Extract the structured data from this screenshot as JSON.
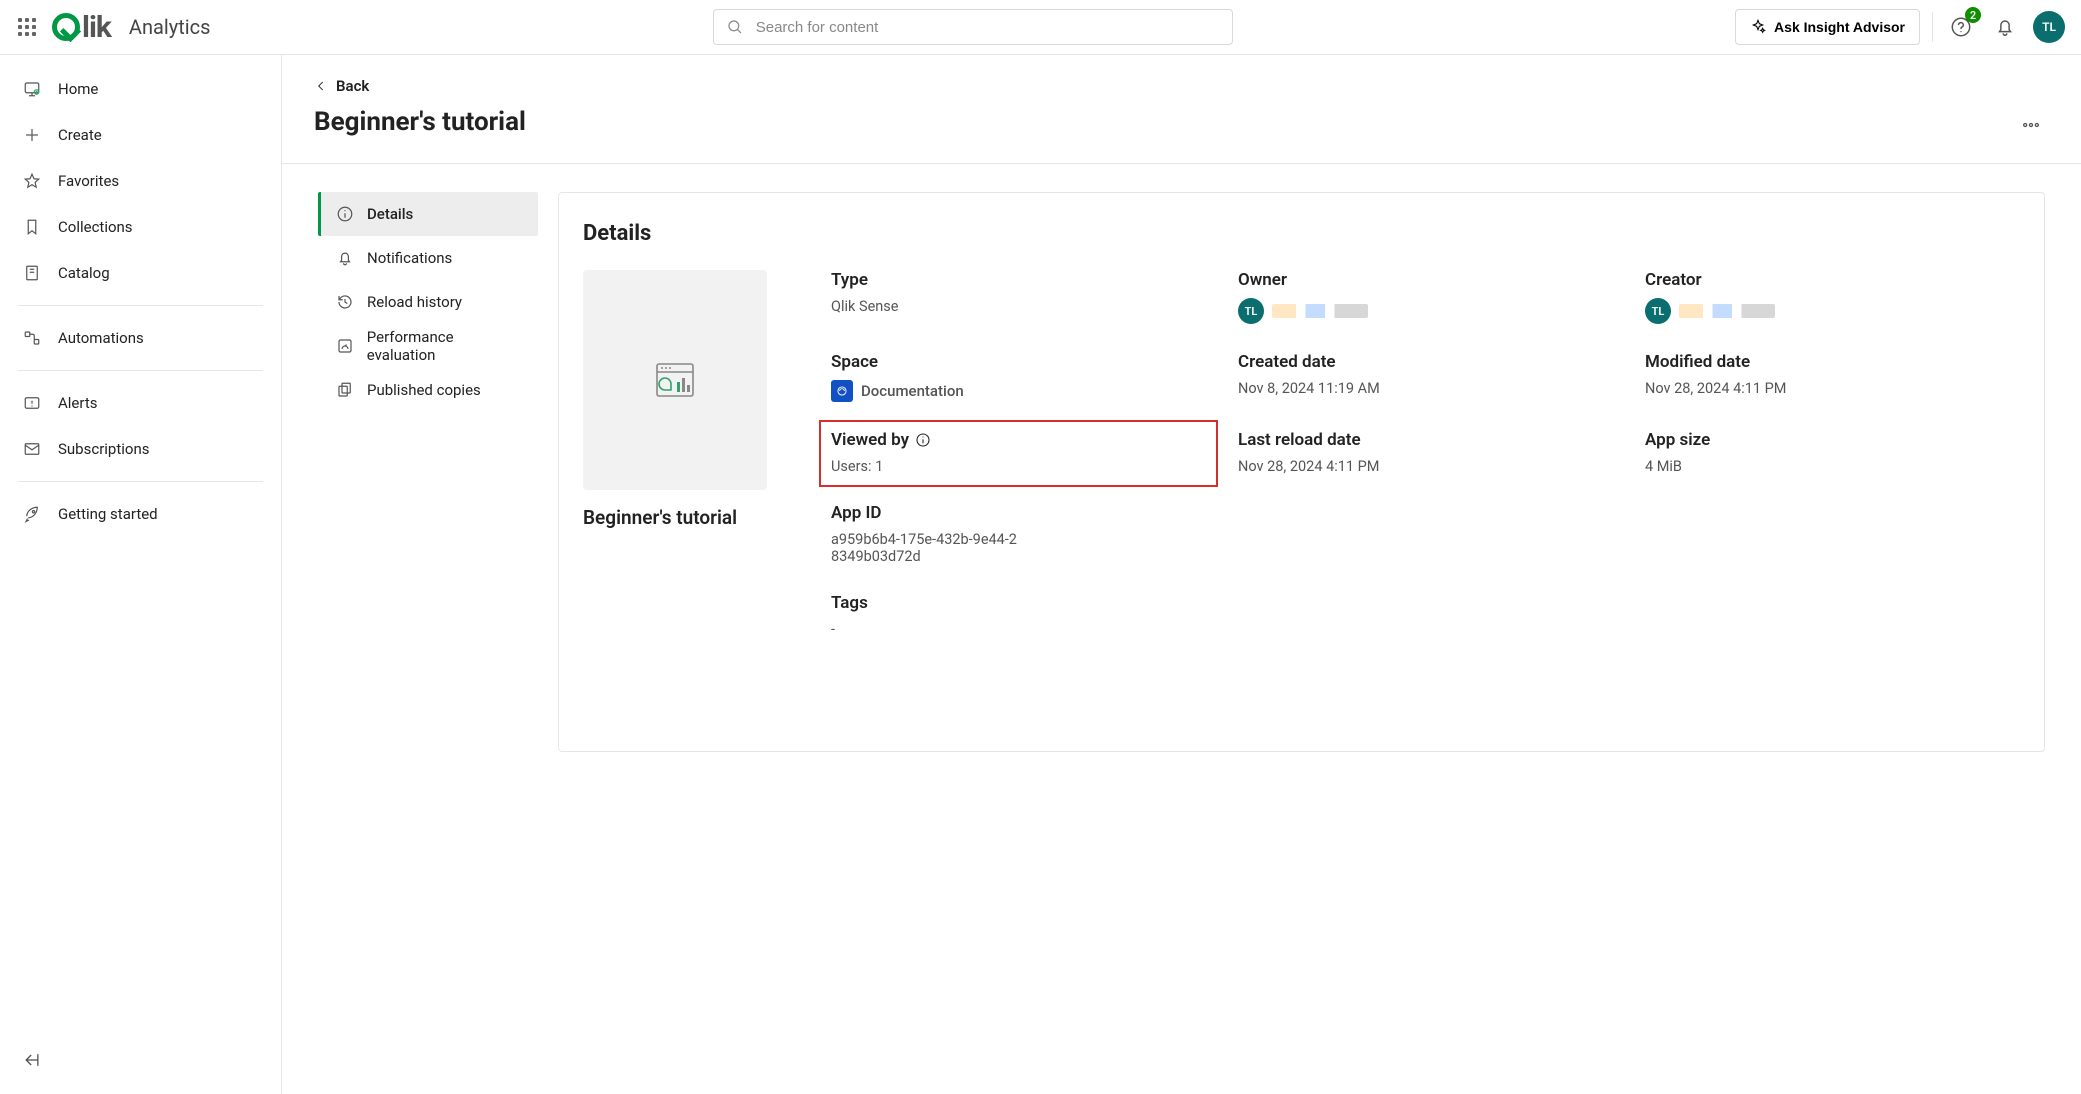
{
  "topbar": {
    "product": "Analytics",
    "search_placeholder": "Search for content",
    "ask_label": "Ask Insight Advisor",
    "notification_count": "2",
    "avatar_initials": "TL"
  },
  "leftnav": {
    "items": [
      {
        "id": "home",
        "label": "Home",
        "icon": "monitor-plus"
      },
      {
        "id": "create",
        "label": "Create",
        "icon": "plus"
      },
      {
        "id": "favorites",
        "label": "Favorites",
        "icon": "star"
      },
      {
        "id": "collections",
        "label": "Collections",
        "icon": "bookmark"
      },
      {
        "id": "catalog",
        "label": "Catalog",
        "icon": "book"
      },
      {
        "sep": true
      },
      {
        "id": "automations",
        "label": "Automations",
        "icon": "flow"
      },
      {
        "sep": true
      },
      {
        "id": "alerts",
        "label": "Alerts",
        "icon": "alert"
      },
      {
        "id": "subscriptions",
        "label": "Subscriptions",
        "icon": "mail"
      },
      {
        "sep": true
      },
      {
        "id": "getting-started",
        "label": "Getting started",
        "icon": "rocket"
      }
    ]
  },
  "header": {
    "back_label": "Back",
    "title": "Beginner's tutorial"
  },
  "sidetabs": [
    {
      "id": "details",
      "label": "Details",
      "icon": "info",
      "active": true
    },
    {
      "id": "notifications",
      "label": "Notifications",
      "icon": "bell"
    },
    {
      "id": "reload-history",
      "label": "Reload history",
      "icon": "history"
    },
    {
      "id": "performance",
      "label": "Performance evaluation",
      "icon": "gauge"
    },
    {
      "id": "published",
      "label": "Published copies",
      "icon": "copies"
    }
  ],
  "panel": {
    "title": "Details",
    "thumb_title": "Beginner's tutorial",
    "fields": {
      "type": {
        "label": "Type",
        "value": "Qlik Sense"
      },
      "owner": {
        "label": "Owner",
        "initials": "TL"
      },
      "creator": {
        "label": "Creator",
        "initials": "TL"
      },
      "space": {
        "label": "Space",
        "value": "Documentation"
      },
      "created_date": {
        "label": "Created date",
        "value": "Nov 8, 2024 11:19 AM"
      },
      "modified_date": {
        "label": "Modified date",
        "value": "Nov 28, 2024 4:11 PM"
      },
      "viewed_by": {
        "label": "Viewed by",
        "value": "Users: 1",
        "highlight": true
      },
      "last_reload_date": {
        "label": "Last reload date",
        "value": "Nov 28, 2024 4:11 PM"
      },
      "app_size": {
        "label": "App size",
        "value": "4 MiB"
      },
      "app_id": {
        "label": "App ID",
        "value": "a959b6b4-175e-432b-9e44-28349b03d72d"
      },
      "tags": {
        "label": "Tags",
        "value": "-"
      }
    }
  }
}
